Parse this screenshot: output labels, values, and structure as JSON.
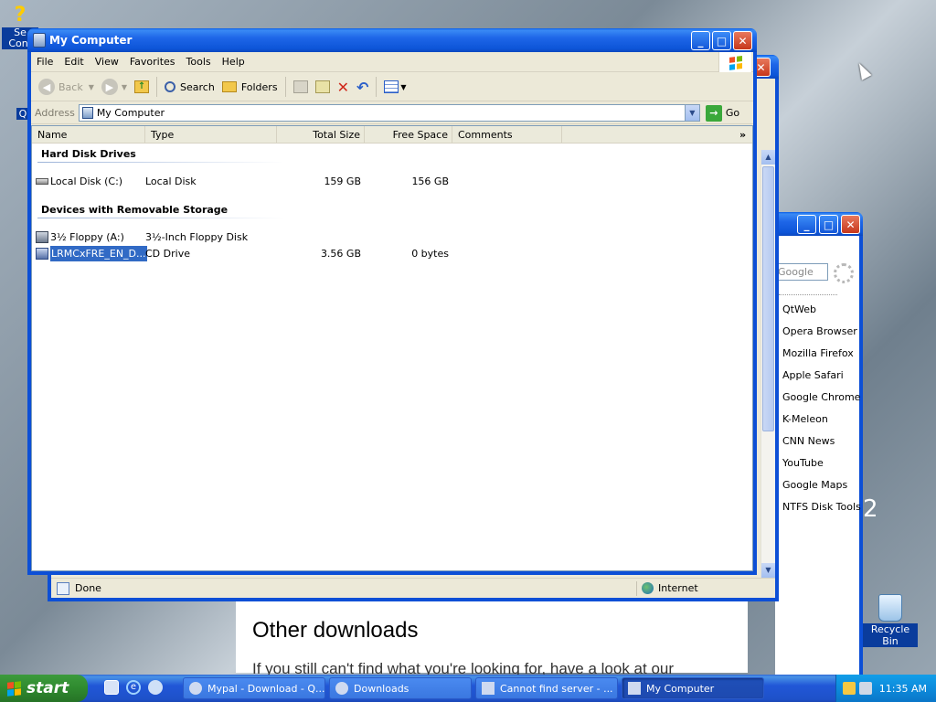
{
  "desktop": {
    "left_icon_partial_text_1": "Se",
    "left_icon_partial_text_2": "Conf",
    "left_icon_partial_text_3": "Q",
    "recycle_bin_label": "Recycle Bin",
    "partial_number": "2"
  },
  "main_window": {
    "title": "My Computer",
    "menu": [
      "File",
      "Edit",
      "View",
      "Favorites",
      "Tools",
      "Help"
    ],
    "toolbar": {
      "back_label": "Back",
      "search_label": "Search",
      "folders_label": "Folders"
    },
    "address": {
      "label": "Address",
      "value": "My Computer",
      "go_label": "Go"
    },
    "columns": [
      "Name",
      "Type",
      "Total Size",
      "Free Space",
      "Comments"
    ],
    "groups": [
      {
        "title": "Hard Disk Drives",
        "items": [
          {
            "name": "Local Disk (C:)",
            "type": "Local Disk",
            "total": "159 GB",
            "free": "156 GB"
          }
        ]
      },
      {
        "title": "Devices with Removable Storage",
        "items": [
          {
            "name": "3½ Floppy (A:)",
            "type": "3½-Inch Floppy Disk",
            "total": "",
            "free": ""
          },
          {
            "name": "LRMCxFRE_EN_D...",
            "type": "CD Drive",
            "total": "3.56 GB",
            "free": "0 bytes"
          }
        ]
      }
    ]
  },
  "background_window": {
    "status_text": "Done",
    "zone_text": "Internet"
  },
  "side_window": {
    "search_placeholder": "Google",
    "links": [
      "QtWeb",
      "Opera Browser",
      "Mozilla Firefox",
      "Apple Safari",
      "Google Chrome",
      "K-Meleon",
      "CNN News",
      "YouTube",
      "Google Maps",
      "NTFS Disk Tools"
    ]
  },
  "webpage": {
    "heading": "Other downloads",
    "paragraph": "If you still can't find what you're looking for, have a look at our"
  },
  "taskbar": {
    "start_label": "start",
    "tasks": [
      "Mypal - Download - Q...",
      "Downloads",
      "Cannot find server - ...",
      "My Computer"
    ],
    "clock": "11:35 AM"
  },
  "colors": {
    "title_blue": "#0c4fd6",
    "selection": "#316ac5",
    "start_green": "#2f8a2f",
    "tray_blue": "#0d8bdc"
  }
}
